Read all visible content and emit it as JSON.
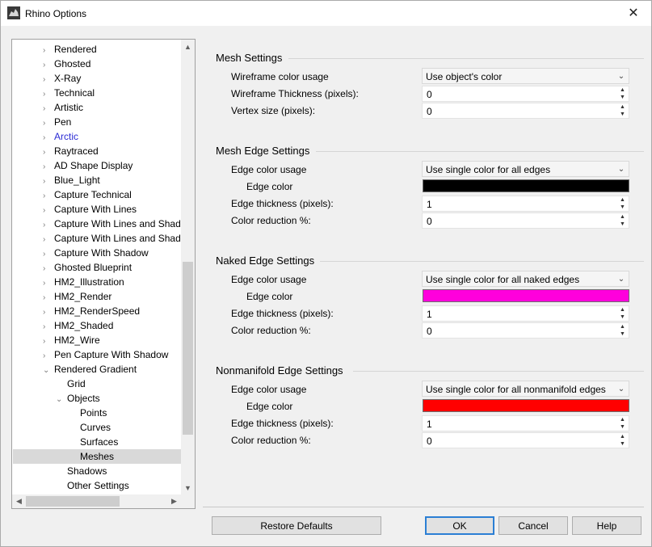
{
  "window": {
    "title": "Rhino Options"
  },
  "tree": {
    "items": [
      {
        "label": "Rendered",
        "expander": "›",
        "indent": 1
      },
      {
        "label": "Ghosted",
        "expander": "›",
        "indent": 1
      },
      {
        "label": "X-Ray",
        "expander": "›",
        "indent": 1
      },
      {
        "label": "Technical",
        "expander": "›",
        "indent": 1
      },
      {
        "label": "Artistic",
        "expander": "›",
        "indent": 1
      },
      {
        "label": "Pen",
        "expander": "›",
        "indent": 1
      },
      {
        "label": "Arctic",
        "expander": "›",
        "indent": 1,
        "link": true
      },
      {
        "label": "Raytraced",
        "expander": "›",
        "indent": 1
      },
      {
        "label": "AD Shape Display",
        "expander": "›",
        "indent": 1
      },
      {
        "label": "Blue_Light",
        "expander": "›",
        "indent": 1
      },
      {
        "label": "Capture Technical",
        "expander": "›",
        "indent": 1
      },
      {
        "label": "Capture With Lines",
        "expander": "›",
        "indent": 1
      },
      {
        "label": "Capture With Lines and Shado",
        "expander": "›",
        "indent": 1
      },
      {
        "label": "Capture With Lines and Shado",
        "expander": "›",
        "indent": 1
      },
      {
        "label": "Capture With Shadow",
        "expander": "›",
        "indent": 1
      },
      {
        "label": "Ghosted Blueprint",
        "expander": "›",
        "indent": 1
      },
      {
        "label": "HM2_Illustration",
        "expander": "›",
        "indent": 1
      },
      {
        "label": "HM2_Render",
        "expander": "›",
        "indent": 1
      },
      {
        "label": "HM2_RenderSpeed",
        "expander": "›",
        "indent": 1
      },
      {
        "label": "HM2_Shaded",
        "expander": "›",
        "indent": 1
      },
      {
        "label": "HM2_Wire",
        "expander": "›",
        "indent": 1
      },
      {
        "label": "Pen Capture With Shadow",
        "expander": "›",
        "indent": 1
      },
      {
        "label": "Rendered Gradient",
        "expander": "⌄",
        "indent": 1
      },
      {
        "label": "Grid",
        "expander": "",
        "indent": 2
      },
      {
        "label": "Objects",
        "expander": "⌄",
        "indent": 2
      },
      {
        "label": "Points",
        "expander": "",
        "indent": 3
      },
      {
        "label": "Curves",
        "expander": "",
        "indent": 3
      },
      {
        "label": "Surfaces",
        "expander": "",
        "indent": 3
      },
      {
        "label": "Meshes",
        "expander": "",
        "indent": 3,
        "selected": true
      },
      {
        "label": "Shadows",
        "expander": "",
        "indent": 2
      },
      {
        "label": "Other Settings",
        "expander": "",
        "indent": 2
      }
    ]
  },
  "mesh_settings": {
    "title": "Mesh Settings",
    "wire_color_label": "Wireframe color usage",
    "wire_color_value": "Use object's color",
    "wire_thickness_label": "Wireframe Thickness (pixels):",
    "wire_thickness_value": "0",
    "vertex_size_label": "Vertex size (pixels):",
    "vertex_size_value": "0"
  },
  "mesh_edge": {
    "title": "Mesh Edge Settings",
    "color_usage_label": "Edge color usage",
    "color_usage_value": "Use single color for all edges",
    "color_label": "Edge color",
    "color": "#000000",
    "thickness_label": "Edge thickness (pixels):",
    "thickness_value": "1",
    "reduction_label": "Color reduction %:",
    "reduction_value": "0"
  },
  "naked_edge": {
    "title": "Naked Edge Settings",
    "color_usage_label": "Edge color usage",
    "color_usage_value": "Use single color for all naked edges",
    "color_label": "Edge color",
    "color": "#ff00dc",
    "thickness_label": "Edge thickness (pixels):",
    "thickness_value": "1",
    "reduction_label": "Color reduction %:",
    "reduction_value": "0"
  },
  "nonmanifold_edge": {
    "title": "Nonmanifold Edge Settings",
    "color_usage_label": "Edge color usage",
    "color_usage_value": "Use single color for all nonmanifold edges",
    "color_label": "Edge color",
    "color": "#ff0000",
    "thickness_label": "Edge thickness (pixels):",
    "thickness_value": "1",
    "reduction_label": "Color reduction %:",
    "reduction_value": "0"
  },
  "buttons": {
    "restore": "Restore Defaults",
    "ok": "OK",
    "cancel": "Cancel",
    "help": "Help"
  },
  "icons": {
    "close": "close-icon",
    "dropdown": "chevron-down-icon",
    "spin_up": "spin-up-icon",
    "spin_down": "spin-down-icon",
    "app": "rhino-icon"
  }
}
